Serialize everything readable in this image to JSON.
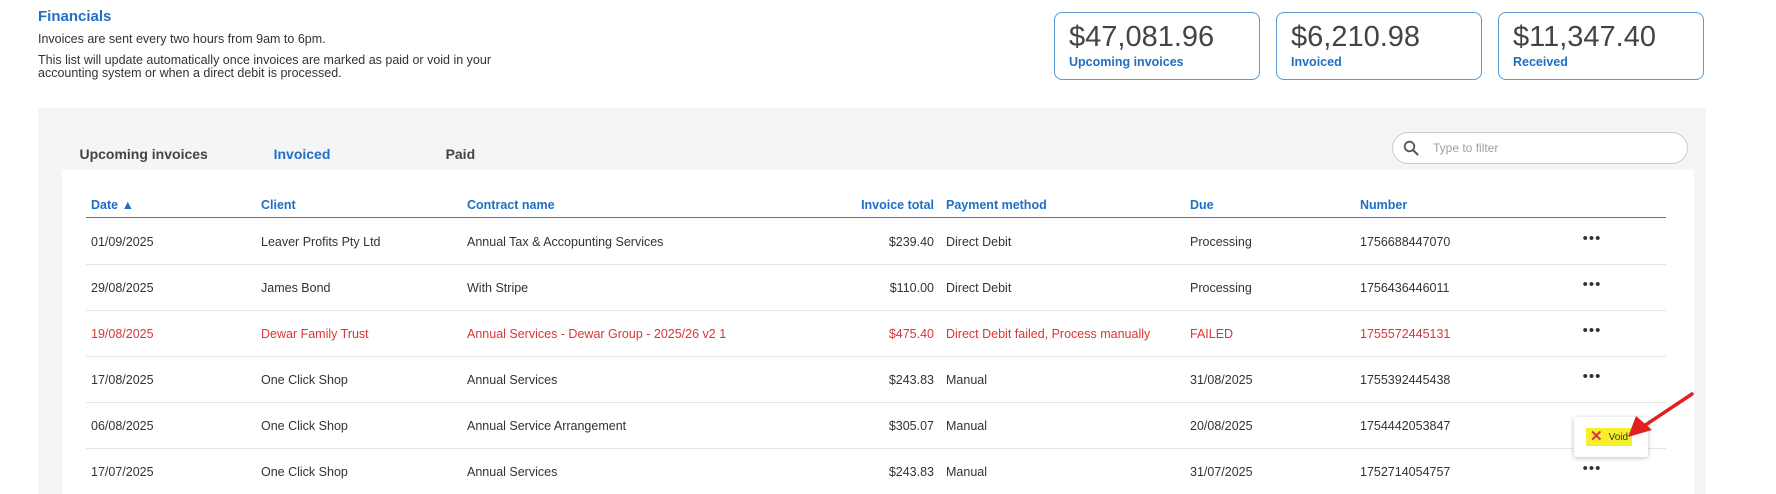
{
  "header": {
    "title": "Financials",
    "desc_line1": "Invoices are sent every two hours from 9am to 6pm.",
    "desc_line2": "This list will update automatically once invoices are marked as paid or void in your accounting system or when a direct debit is processed."
  },
  "stats": [
    {
      "value": "$47,081.96",
      "label": "Upcoming invoices"
    },
    {
      "value": "$6,210.98",
      "label": "Invoiced"
    },
    {
      "value": "$11,347.40",
      "label": "Received"
    }
  ],
  "tabs": [
    {
      "label": "Upcoming invoices"
    },
    {
      "label": "Invoiced"
    },
    {
      "label": "Paid"
    }
  ],
  "filter": {
    "placeholder": "Type to filter"
  },
  "columns": {
    "date": "Date ▲",
    "client": "Client",
    "contract": "Contract name",
    "total": "Invoice total",
    "method": "Payment method",
    "due": "Due",
    "number": "Number"
  },
  "rows": [
    {
      "date": "01/09/2025",
      "client": "Leaver Profits Pty Ltd",
      "contract": "Annual Tax & Accopunting Services",
      "total": "$239.40",
      "method": "Direct Debit",
      "due": "Processing",
      "number": "1756688447070",
      "more": "•••"
    },
    {
      "date": "29/08/2025",
      "client": "James Bond",
      "contract": "With Stripe",
      "total": "$110.00",
      "method": "Direct Debit",
      "due": "Processing",
      "number": "1756436446011",
      "more": "•••"
    },
    {
      "date": "19/08/2025",
      "client": "Dewar Family Trust",
      "contract": "Annual Services - Dewar Group - 2025/26 v2 1",
      "total": "$475.40",
      "method": "Direct Debit failed, Process manually",
      "due": "FAILED",
      "number": "1755572445131",
      "more": "•••"
    },
    {
      "date": "17/08/2025",
      "client": "One Click Shop",
      "contract": "Annual Services",
      "total": "$243.83",
      "method": "Manual",
      "due": "31/08/2025",
      "number": "1755392445438",
      "more": "•••"
    },
    {
      "date": "06/08/2025",
      "client": "One Click Shop",
      "contract": "Annual Service Arrangement",
      "total": "$305.07",
      "method": "Manual",
      "due": "20/08/2025",
      "number": "1754442053847",
      "more": ""
    },
    {
      "date": "17/07/2025",
      "client": "One Click Shop",
      "contract": "Annual Services",
      "total": "$243.83",
      "method": "Manual",
      "due": "31/07/2025",
      "number": "1752714054757",
      "more": "•••"
    }
  ],
  "void_menu": {
    "icon": "✕",
    "label": "Void"
  },
  "colors": {
    "accent": "#1f6fc5",
    "failed": "#d93636",
    "highlight": "#f5ef2c",
    "annotation_arrow": "#e02020"
  }
}
